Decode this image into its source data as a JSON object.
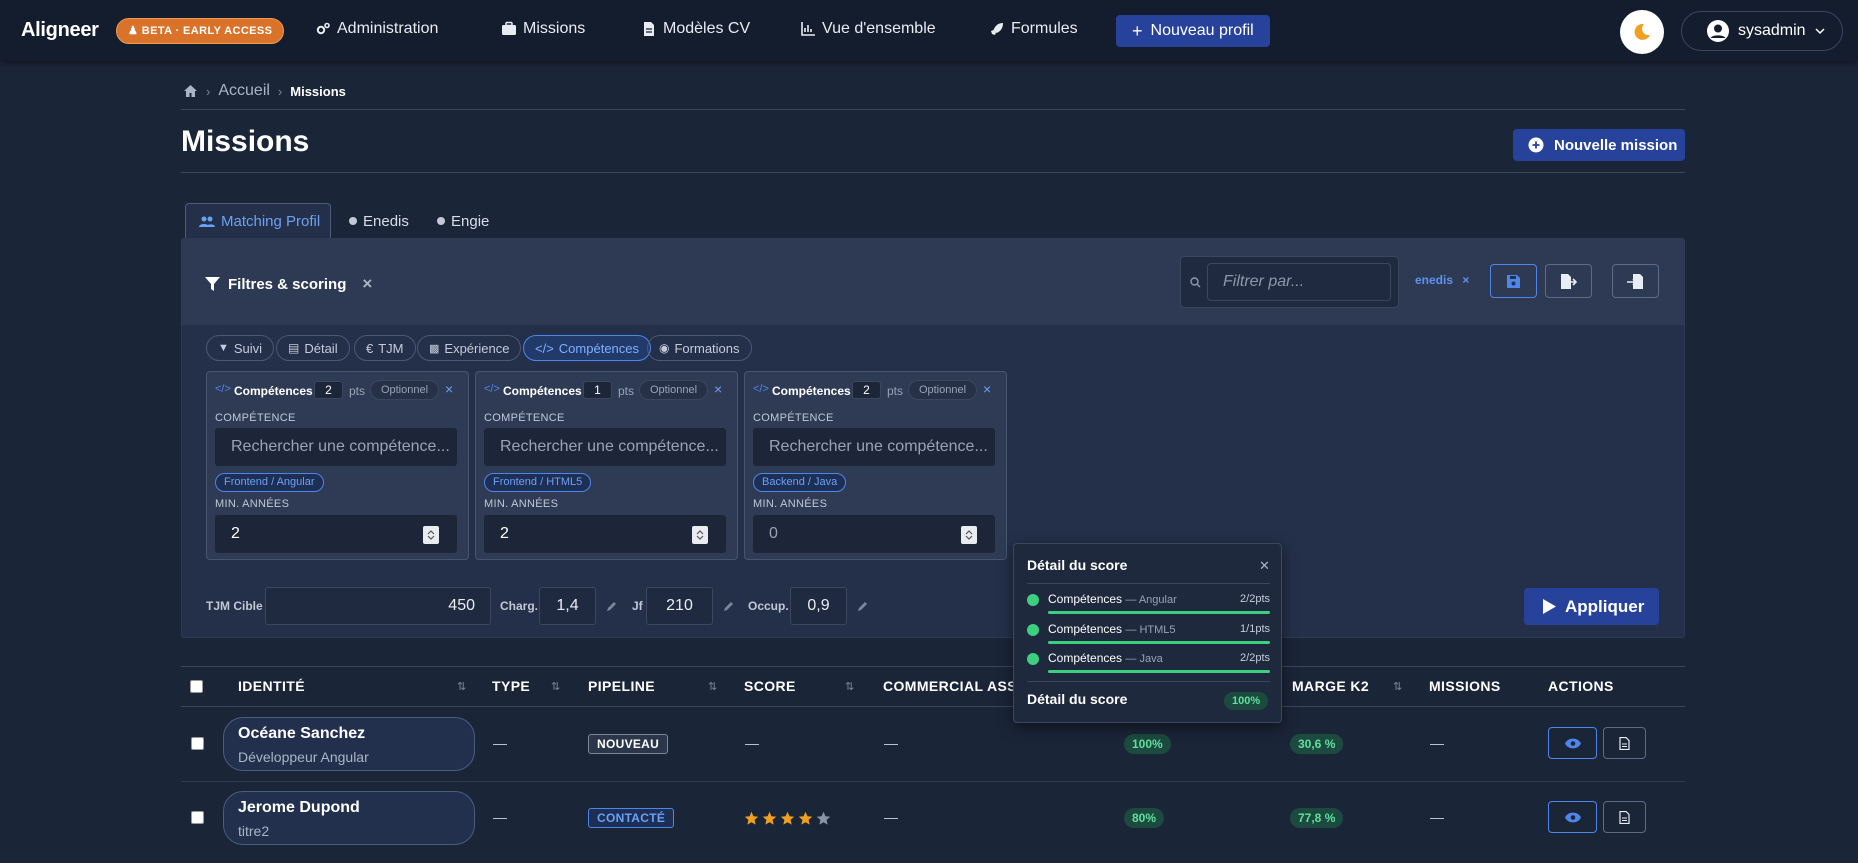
{
  "nav": {
    "brand": "Aligneer",
    "beta": "BETA · EARLY ACCESS",
    "items": [
      "Administration",
      "Missions",
      "Modèles CV",
      "Vue d'ensemble",
      "Formules"
    ],
    "new_profile": "Nouveau profil",
    "user": "sysadmin"
  },
  "breadcrumb": {
    "home": "Accueil",
    "current": "Missions"
  },
  "page": {
    "title": "Missions",
    "new_mission": "Nouvelle mission"
  },
  "tabs": [
    {
      "label": "Matching Profil",
      "active": true
    },
    {
      "label": "Enedis",
      "active": false
    },
    {
      "label": "Engie",
      "active": false
    }
  ],
  "filters": {
    "title": "Filtres & scoring",
    "search_placeholder": "Filtrer par...",
    "chip": "enedis",
    "pills": [
      "Suivi",
      "Détail",
      "TJM",
      "Expérience",
      "Compétences",
      "Formations"
    ],
    "active_pill": "Compétences"
  },
  "cards": [
    {
      "title": "Compétences",
      "pts": "2",
      "pts_unit": "pts",
      "optional": "Optionnel",
      "comp_label": "COMPÉTENCE",
      "placeholder": "Rechercher une compétence...",
      "tag": "Frontend / Angular",
      "years_label": "MIN. ANNÉES",
      "years": "2"
    },
    {
      "title": "Compétences",
      "pts": "1",
      "pts_unit": "pts",
      "optional": "Optionnel",
      "comp_label": "COMPÉTENCE",
      "placeholder": "Rechercher une compétence...",
      "tag": "Frontend / HTML5",
      "years_label": "MIN. ANNÉES",
      "years": "2"
    },
    {
      "title": "Compétences",
      "pts": "2",
      "pts_unit": "pts",
      "optional": "Optionnel",
      "comp_label": "COMPÉTENCE",
      "placeholder": "Rechercher une compétence...",
      "tag": "Backend / Java",
      "years_label": "MIN. ANNÉES",
      "years": "0"
    }
  ],
  "params": {
    "tjm_label": "TJM Cible",
    "tjm": "450",
    "charg_label": "Charg.",
    "charg": "1,4",
    "jf_label": "Jf",
    "jf": "210",
    "occup_label": "Occup.",
    "occup": "0,9",
    "apply": "Appliquer"
  },
  "score_popup": {
    "title": "Détail du score",
    "lines": [
      {
        "label": "Compétences",
        "detail": "— Angular",
        "value": "2/2pts",
        "fill": 1.0
      },
      {
        "label": "Compétences",
        "detail": "— HTML5",
        "value": "1/1pts",
        "fill": 1.0
      },
      {
        "label": "Compétences",
        "detail": "— Java",
        "value": "2/2pts",
        "fill": 1.0
      }
    ],
    "footer": "Détail du score",
    "total": "100%"
  },
  "table": {
    "headers": [
      "IDENTITÉ",
      "TYPE",
      "PIPELINE",
      "SCORE",
      "COMMERCIAL ASS",
      "MARGE K2",
      "MISSIONS",
      "ACTIONS"
    ],
    "rows": [
      {
        "name": "Océane Sanchez",
        "title": "Développeur Angular",
        "type": "—",
        "pipeline": "NOUVEAU",
        "score": "—",
        "commercial": "—",
        "match": "100%",
        "marge": "30,6 %",
        "missions": "—"
      },
      {
        "name": "Jerome Dupond",
        "title": "titre2",
        "type": "—",
        "pipeline": "CONTACTÉ",
        "stars": 4,
        "commercial": "—",
        "match": "80%",
        "marge": "77,8 %",
        "missions": "—"
      }
    ]
  },
  "colors": {
    "accent": "#27429a",
    "beta": "#d9732a",
    "success": "#3ccf7f",
    "star": "#f0a020"
  }
}
